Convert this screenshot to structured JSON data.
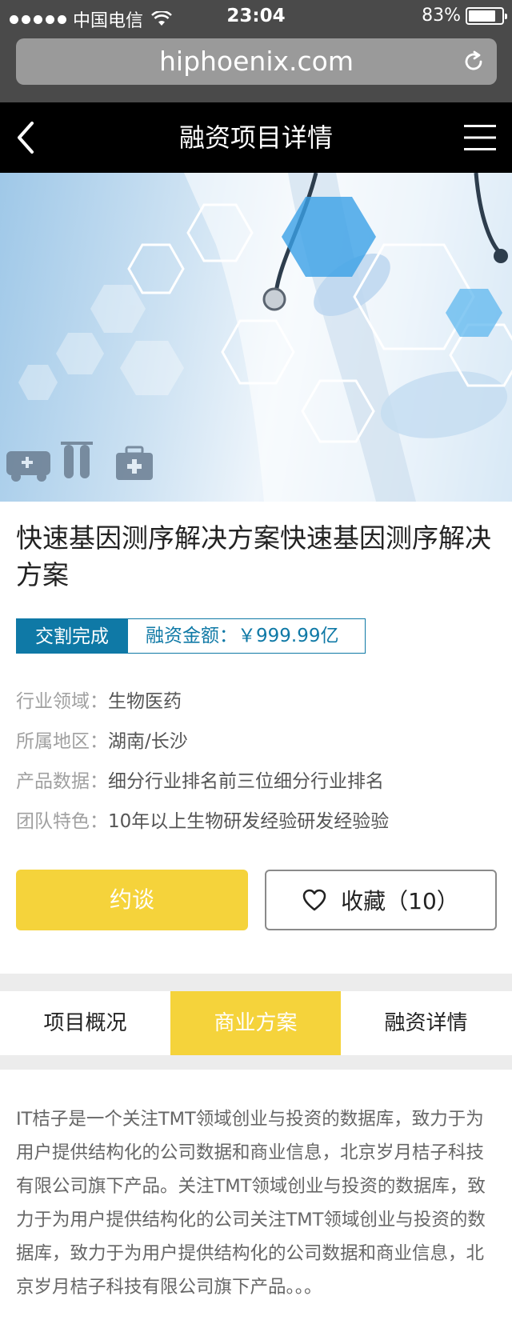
{
  "status_bar": {
    "carrier": "中国电信",
    "time": "23:04",
    "battery_text": "83%",
    "battery_level": 0.83,
    "signal_icon": "signal-dots-icon",
    "wifi_icon": "wifi-icon"
  },
  "browser": {
    "url": "hiphoenix.com",
    "reload_icon": "reload-icon"
  },
  "header": {
    "title": "融资项目详情",
    "back_icon": "back-chevron-icon",
    "menu_icon": "hamburger-menu-icon"
  },
  "hero": {
    "image_desc_icon": "medical-hero-image",
    "icons": [
      "ambulance-icon",
      "test-tubes-icon",
      "medical-kit-icon"
    ]
  },
  "project": {
    "title": "快速基因测序解决方案快速基因测序解决方案",
    "status_tag": "交割完成",
    "amount_tag": "融资金额：￥999.99亿",
    "info": [
      {
        "label": "行业领域：",
        "value": "生物医药"
      },
      {
        "label": "所属地区：",
        "value": "湖南/长沙"
      },
      {
        "label": "产品数据：",
        "value": "细分行业排名前三位细分行业排名"
      },
      {
        "label": "团队特色：",
        "value": "10年以上生物研发经验研发经验验"
      }
    ]
  },
  "actions": {
    "talk_label": "约谈",
    "favorite_label": "收藏（10）",
    "favorite_icon": "heart-icon"
  },
  "tabs": [
    {
      "label": "项目概况",
      "active": false
    },
    {
      "label": "商业方案",
      "active": true
    },
    {
      "label": "融资详情",
      "active": false
    }
  ],
  "description": "IT桔子是一个关注TMT领域创业与投资的数据库，致力于为用户提供结构化的公司数据和商业信息，北京岁月桔子科技有限公司旗下产品。关注TMT领域创业与投资的数据库，致力于为用户提供结构化的公司关注TMT领域创业与投资的数据库，致力于为用户提供结构化的公司数据和商业信息，北京岁月桔子科技有限公司旗下产品。。。",
  "colors": {
    "accent_yellow": "#f5d33b",
    "accent_blue": "#0f79a6",
    "header_bg": "#000000",
    "chrome_bg": "#4a4a4a"
  }
}
